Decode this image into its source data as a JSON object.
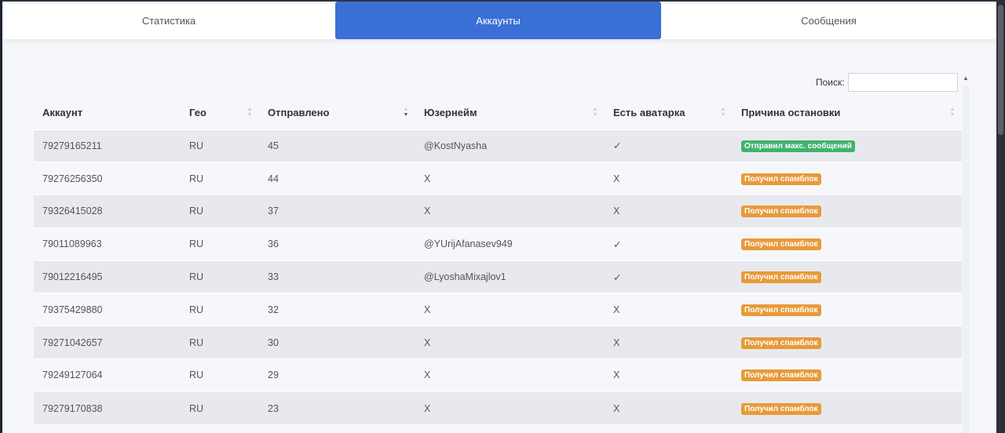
{
  "tabs": [
    {
      "label": "Статистика"
    },
    {
      "label": "Аккаунты"
    },
    {
      "label": "Сообщения"
    }
  ],
  "search": {
    "label": "Поиск:",
    "value": ""
  },
  "table": {
    "columns": [
      "Аккаунт",
      "Гео",
      "Отправлено",
      "Юзернейм",
      "Есть аватарка",
      "Причина остановки"
    ],
    "rows": [
      {
        "account": "79279165211",
        "geo": "RU",
        "sent": "45",
        "username": "@KostNyasha",
        "avatar": "✓",
        "reason": "Отправил макс. сообщений",
        "reason_color": "#3fb36c"
      },
      {
        "account": "79276256350",
        "geo": "RU",
        "sent": "44",
        "username": "X",
        "avatar": "X",
        "reason": "Получил спамблок",
        "reason_color": "#e89a3a"
      },
      {
        "account": "79326415028",
        "geo": "RU",
        "sent": "37",
        "username": "X",
        "avatar": "X",
        "reason": "Получил спамблок",
        "reason_color": "#e89a3a"
      },
      {
        "account": "79011089963",
        "geo": "RU",
        "sent": "36",
        "username": "@YUrijAfanasev949",
        "avatar": "✓",
        "reason": "Получил спамблок",
        "reason_color": "#e89a3a"
      },
      {
        "account": "79012216495",
        "geo": "RU",
        "sent": "33",
        "username": "@LyoshaMixajlov1",
        "avatar": "✓",
        "reason": "Получил спамблок",
        "reason_color": "#e89a3a"
      },
      {
        "account": "79375429880",
        "geo": "RU",
        "sent": "32",
        "username": "X",
        "avatar": "X",
        "reason": "Получил спамблок",
        "reason_color": "#e89a3a"
      },
      {
        "account": "79271042657",
        "geo": "RU",
        "sent": "30",
        "username": "X",
        "avatar": "X",
        "reason": "Получил спамблок",
        "reason_color": "#e89a3a"
      },
      {
        "account": "79249127064",
        "geo": "RU",
        "sent": "29",
        "username": "X",
        "avatar": "X",
        "reason": "Получил спамблок",
        "reason_color": "#e89a3a"
      },
      {
        "account": "79279170838",
        "geo": "RU",
        "sent": "23",
        "username": "X",
        "avatar": "X",
        "reason": "Получил спамблок",
        "reason_color": "#e89a3a"
      }
    ]
  }
}
